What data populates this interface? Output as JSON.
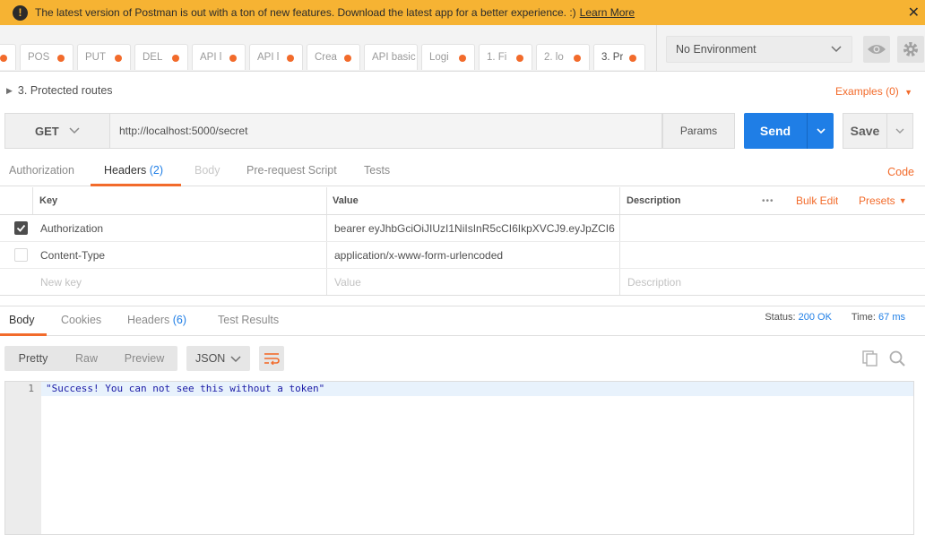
{
  "banner": {
    "message": "The latest version of Postman is out with a ton of new features. Download the latest app for a better experience. :)",
    "link": "Learn More",
    "close": "✕"
  },
  "tabs": [
    {
      "label": ""
    },
    {
      "label": "POS"
    },
    {
      "label": "PUT"
    },
    {
      "label": "DEL"
    },
    {
      "label": "API l"
    },
    {
      "label": "API l"
    },
    {
      "label": "Crea"
    },
    {
      "label": "API basic"
    },
    {
      "label": "Logi"
    },
    {
      "label": "1. Fi"
    },
    {
      "label": "2. lo"
    },
    {
      "label": "3. Pr"
    }
  ],
  "environment": {
    "selected": "No Environment"
  },
  "request": {
    "name": "3. Protected routes",
    "examples": "Examples (0)",
    "method": "GET",
    "url": "http://localhost:5000/secret",
    "params_label": "Params",
    "send_label": "Send",
    "save_label": "Save"
  },
  "request_tabs": {
    "authorization": "Authorization",
    "headers": "Headers",
    "headers_count": "(2)",
    "body": "Body",
    "pre_request": "Pre-request Script",
    "tests": "Tests",
    "code": "Code"
  },
  "headers_table": {
    "columns": {
      "key": "Key",
      "value": "Value",
      "description": "Description"
    },
    "more": "•••",
    "bulk_edit": "Bulk Edit",
    "presets": "Presets",
    "rows": [
      {
        "key": "Authorization",
        "value": "bearer eyJhbGciOiJIUzI1NiIsInR5cCI6IkpXVCJ9.eyJpZCI6…",
        "description": "",
        "checked": true
      },
      {
        "key": "Content-Type",
        "value": "application/x-www-form-urlencoded",
        "description": "",
        "checked": false
      }
    ],
    "new_row": {
      "key": "New key",
      "value": "Value",
      "description": "Description"
    }
  },
  "response_tabs": {
    "body": "Body",
    "cookies": "Cookies",
    "headers": "Headers",
    "headers_count": "(6)",
    "test_results": "Test Results"
  },
  "response_status": {
    "status_label": "Status:",
    "status_value": "200 OK",
    "time_label": "Time:",
    "time_value": "67 ms"
  },
  "response_view": {
    "pretty": "Pretty",
    "raw": "Raw",
    "preview": "Preview",
    "format": "JSON"
  },
  "response_body": {
    "line_number": "1",
    "content": "\"Success! You can not see this without a token\""
  },
  "colors": {
    "accent": "#f26b2b",
    "primary": "#1f7ee6",
    "banner": "#f6b333"
  }
}
